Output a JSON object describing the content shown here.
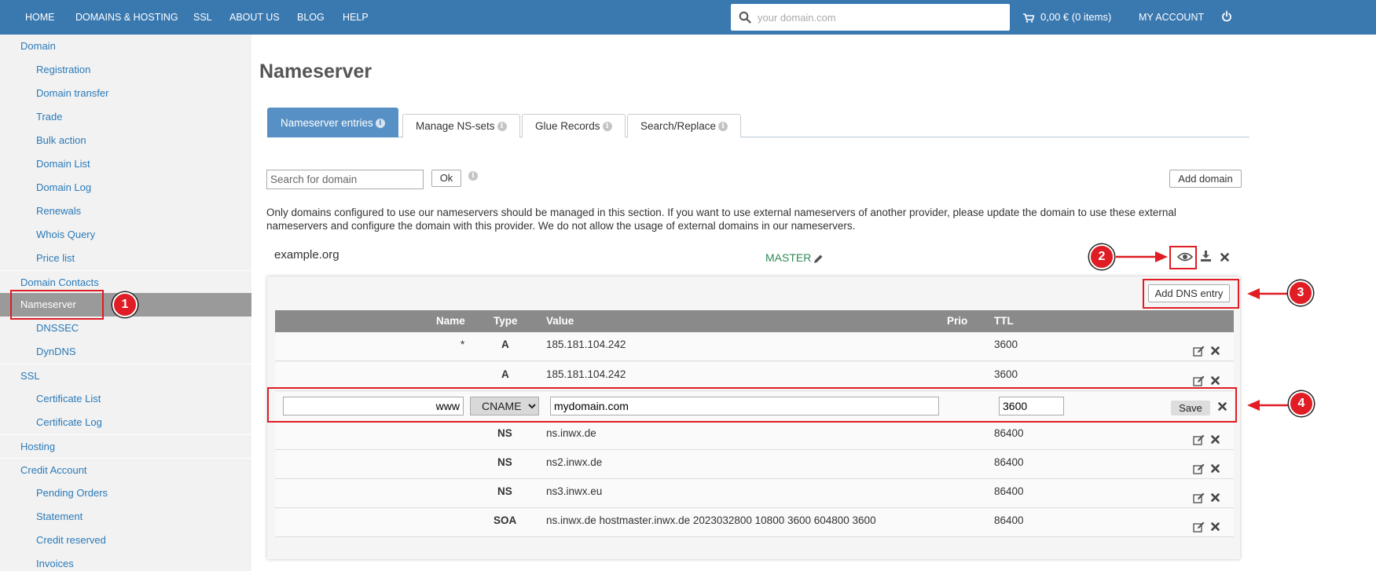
{
  "topnav": {
    "items": [
      "HOME",
      "DOMAINS & HOSTING",
      "SSL",
      "ABOUT US",
      "BLOG",
      "HELP"
    ],
    "search_placeholder": "your domain.com",
    "cart_label": "0,00 € (0 items)",
    "account_label": "MY ACCOUNT"
  },
  "sidebar": {
    "items": [
      {
        "label": "Domain",
        "level": 0
      },
      {
        "label": "Registration",
        "level": 1
      },
      {
        "label": "Domain transfer",
        "level": 1
      },
      {
        "label": "Trade",
        "level": 1
      },
      {
        "label": "Bulk action",
        "level": 1
      },
      {
        "label": "Domain List",
        "level": 1
      },
      {
        "label": "Domain Log",
        "level": 1
      },
      {
        "label": "Renewals",
        "level": 1
      },
      {
        "label": "Whois Query",
        "level": 1
      },
      {
        "label": "Price list",
        "level": 1
      },
      {
        "label": "Domain Contacts",
        "level": 0
      },
      {
        "label": "Nameserver",
        "level": 0,
        "active": true
      },
      {
        "label": "DNSSEC",
        "level": 1
      },
      {
        "label": "DynDNS",
        "level": 1
      },
      {
        "label": "SSL",
        "level": 0
      },
      {
        "label": "Certificate List",
        "level": 1
      },
      {
        "label": "Certificate Log",
        "level": 1
      },
      {
        "label": "Hosting",
        "level": 0
      },
      {
        "label": "Credit Account",
        "level": 0
      },
      {
        "label": "Pending Orders",
        "level": 1
      },
      {
        "label": "Statement",
        "level": 1
      },
      {
        "label": "Credit reserved",
        "level": 1
      },
      {
        "label": "Invoices",
        "level": 1
      }
    ]
  },
  "page": {
    "title": "Nameserver",
    "tabs": [
      {
        "label": "Nameserver entries",
        "active": true
      },
      {
        "label": "Manage NS-sets"
      },
      {
        "label": "Glue Records"
      },
      {
        "label": "Search/Replace"
      }
    ],
    "search_placeholder": "Search for domain",
    "ok_label": "Ok",
    "add_domain_label": "Add domain",
    "notice_line1": "Only domains configured to use our nameservers should be managed in this section. If you want to use external nameservers of another provider, please update the domain to use these external",
    "notice_line2": "nameservers and configure the domain with this provider. We do not allow the usage of external domains in our nameservers."
  },
  "domain": {
    "name": "example.org",
    "mode": "MASTER"
  },
  "dns": {
    "add_label": "Add DNS entry",
    "headers": {
      "name": "Name",
      "type": "Type",
      "value": "Value",
      "prio": "Prio",
      "ttl": "TTL"
    },
    "records_top": [
      {
        "name": "*",
        "type": "A",
        "value": "185.181.104.242",
        "prio": "",
        "ttl": "3600"
      },
      {
        "name": "",
        "type": "A",
        "value": "185.181.104.242",
        "prio": "",
        "ttl": "3600"
      }
    ],
    "edit": {
      "name": "www",
      "type": "CNAME",
      "value": "mydomain.com",
      "ttl": "3600",
      "save_label": "Save"
    },
    "records_bottom": [
      {
        "name": "",
        "type": "NS",
        "value": "ns.inwx.de",
        "prio": "",
        "ttl": "86400"
      },
      {
        "name": "",
        "type": "NS",
        "value": "ns2.inwx.de",
        "prio": "",
        "ttl": "86400"
      },
      {
        "name": "",
        "type": "NS",
        "value": "ns3.inwx.eu",
        "prio": "",
        "ttl": "86400"
      },
      {
        "name": "",
        "type": "SOA",
        "value": "ns.inwx.de hostmaster.inwx.de 2023032800 10800 3600 604800 3600",
        "prio": "",
        "ttl": "86400"
      }
    ]
  },
  "annotations": {
    "badges": [
      "1",
      "2",
      "3",
      "4"
    ],
    "color": "#e01c24"
  }
}
